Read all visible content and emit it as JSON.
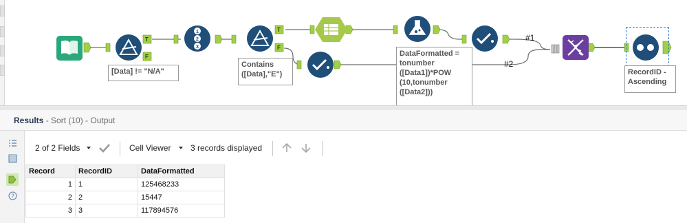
{
  "canvas": {
    "annotations": {
      "filter1": "[Data] != \"N/A\"",
      "filter2": "Contains\n([Data],\"E\")",
      "formula": "DataFormatted =\ntonumber\n([Data1])*POW\n(10,tonumber\n([Data2]))",
      "sort": "RecordID -\nAscending"
    },
    "connection_labels": [
      "#1",
      "#2"
    ],
    "anchor_labels": {
      "true": "T",
      "false": "F"
    },
    "colors": {
      "input_tool": "#2aa87c",
      "preparation_tool": "#1f4e79",
      "join_tool": "#a7c94b",
      "formula_tool": "#1f4e79",
      "transform_tool": "#6b3fa0",
      "anchor": "#a2cf47",
      "link": "#6e6e6e",
      "selected_link": "#3aa657"
    }
  },
  "results": {
    "title": "Results",
    "subtitle": " - Sort (10) - Output",
    "toolbar": {
      "fields": "2 of 2 Fields",
      "viewer": "Cell Viewer",
      "records": "3 records displayed"
    },
    "side_icons": [
      "list-icon",
      "table-icon",
      "data-tag-icon",
      "help-icon"
    ],
    "columns": [
      "Record",
      "RecordID",
      "DataFormatted"
    ],
    "rows": [
      {
        "record": "1",
        "id": "1",
        "value": "125468233"
      },
      {
        "record": "2",
        "id": "2",
        "value": "15447"
      },
      {
        "record": "3",
        "id": "3",
        "value": "117894576"
      }
    ]
  }
}
